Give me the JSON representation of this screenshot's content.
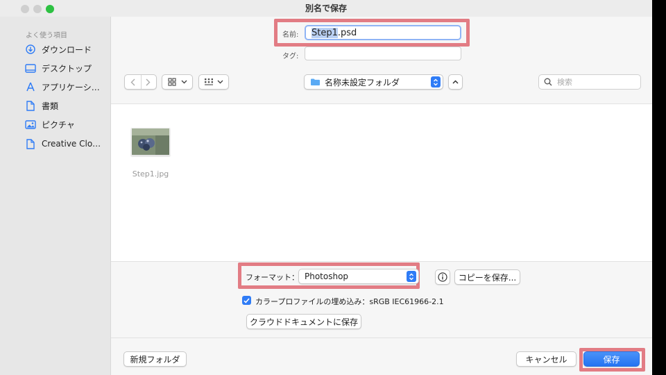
{
  "window": {
    "title": "別名で保存"
  },
  "sidebar": {
    "heading": "よく使う項目",
    "items": [
      {
        "label": "ダウンロード",
        "icon": "download-icon"
      },
      {
        "label": "デスクトップ",
        "icon": "desktop-icon"
      },
      {
        "label": "アプリケーシ…",
        "icon": "applications-icon"
      },
      {
        "label": "書類",
        "icon": "document-icon"
      },
      {
        "label": "ピクチャ",
        "icon": "pictures-icon"
      },
      {
        "label": "Creative Clo…",
        "icon": "file-icon"
      }
    ]
  },
  "save": {
    "name_label": "名前:",
    "name_selected": "Step1",
    "name_rest": ".psd",
    "tags_label": "タグ:",
    "tags_value": ""
  },
  "toolbar": {
    "location": "名称未設定フォルダ",
    "search_placeholder": "検索"
  },
  "files": [
    {
      "name": "Step1.jpg"
    }
  ],
  "options": {
    "format_label": "フォーマット：",
    "format_value": "Photoshop",
    "copy_button": "コピーを保存...",
    "embed_profile_label": "カラープロファイルの埋め込み：sRGB IEC61966-2.1",
    "embed_profile_checked": true,
    "cloud_button": "クラウドドキュメントに保存"
  },
  "footer": {
    "new_folder": "新規フォルダ",
    "cancel": "キャンセル",
    "save": "保存"
  },
  "colors": {
    "accent": "#2f7cf6",
    "highlight": "#e27c84"
  }
}
